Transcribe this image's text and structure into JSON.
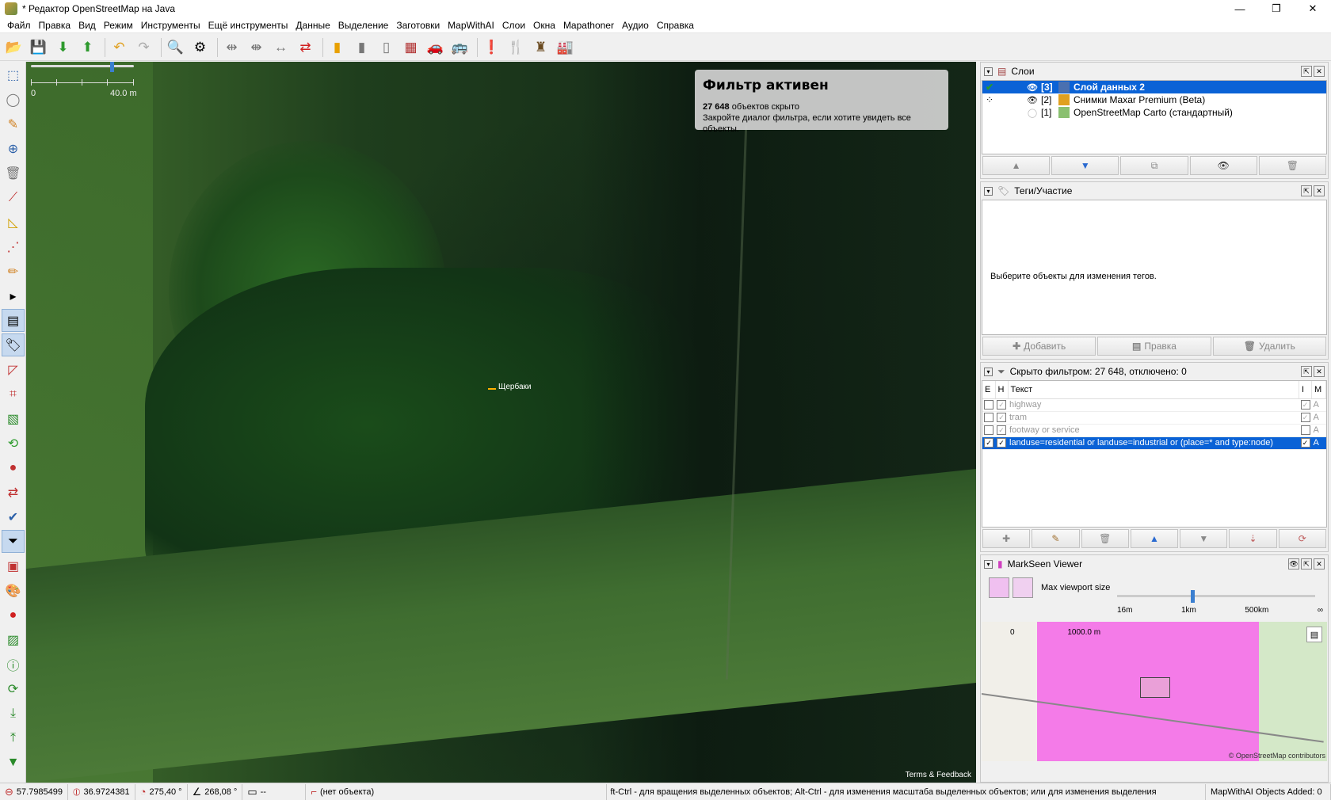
{
  "window": {
    "title": "* Редактор OpenStreetMap на Java",
    "controls": [
      "—",
      "❐",
      "✕"
    ]
  },
  "menu": [
    "Файл",
    "Правка",
    "Вид",
    "Режим",
    "Инструменты",
    "Ещё инструменты",
    "Данные",
    "Выделение",
    "Заготовки",
    "MapWithAI",
    "Слои",
    "Окна",
    "Mapathoner",
    "Аудио",
    "Справка"
  ],
  "toolbar_icons": [
    "open-icon",
    "save-icon",
    "download-icon",
    "upload-icon",
    "undo-icon",
    "redo-icon",
    "zoom-icon",
    "preferences-icon",
    "align-icon",
    "distribute-icon",
    "split-icon",
    "reverse-icon",
    "highway-icon",
    "road-icon",
    "pole-icon",
    "wall-icon",
    "car-icon",
    "bus-icon",
    "warning-icon",
    "restaurant-icon",
    "castle-icon",
    "factory-icon"
  ],
  "left_tools": [
    "select-icon",
    "lasso-icon",
    "draw-icon",
    "zoom-icon",
    "delete-icon",
    "improve-way-icon",
    "measure-icon",
    "split-way-icon",
    "paint-icon",
    "more-icon",
    "layers-icon",
    "tags-icon",
    "relation-icon",
    "node-icon",
    "map-icon",
    "sync-icon",
    "group-icon",
    "conflict-icon",
    "validate-icon",
    "filter-icon",
    "notes-icon",
    "palette-icon",
    "marker-icon",
    "image-icon",
    "info-icon",
    "history-icon",
    "download-icon",
    "upload-icon",
    "filter-toggle-icon"
  ],
  "map": {
    "scale_left": "0",
    "scale_right": "40.0 m",
    "filter_title": "Фильтр активен",
    "filter_count": "27 648",
    "filter_count_suffix": " объектов скрыто",
    "filter_hint": "Закройте диалог фильтра, если хотите увидеть все объекты.",
    "place_label": "Щербаки",
    "attribution": "Terms & Feedback"
  },
  "layers_panel": {
    "title": "Слои",
    "layers": [
      {
        "num": "[3]",
        "name": "Слой данных 2",
        "selected": true
      },
      {
        "num": "[2]",
        "name": "Снимки Maxar Premium (Beta)",
        "selected": false
      },
      {
        "num": "[1]",
        "name": "OpenStreetMap Carto (стандартный)",
        "selected": false
      }
    ]
  },
  "tags_panel": {
    "title": "Теги/Участие",
    "empty_message": "Выберите объекты для изменения тегов.",
    "add_label": "Добавить",
    "edit_label": "Правка",
    "delete_label": "Удалить"
  },
  "filter_panel": {
    "title": "Скрыто фильтром: 27 648, отключено: 0",
    "col_e": "E",
    "col_h": "H",
    "col_text": "Текст",
    "col_i": "I",
    "col_m": "M",
    "rows": [
      {
        "text": "highway",
        "m": "A",
        "selected": false
      },
      {
        "text": "tram",
        "m": "A",
        "selected": false
      },
      {
        "text": "footway or service",
        "m": "A",
        "selected": false
      },
      {
        "text": "landuse=residential or landuse=industrial or (place=* and type:node)",
        "m": "A",
        "selected": true
      }
    ]
  },
  "markseen_panel": {
    "title": "MarkSeen Viewer",
    "slider_label": "Max viewport size",
    "ticks": [
      "16m",
      "1km",
      "500km",
      "∞"
    ],
    "minimap_scale_left": "0",
    "minimap_scale_right": "1000.0 m",
    "minimap_attribution": "© OpenStreetMap contributors"
  },
  "status": {
    "lat": "57.7985499",
    "lon": "36.9724381",
    "heading": "275,40 °",
    "angle": "268,08 °",
    "distance": "--",
    "object": "(нет объекта)",
    "hint": "ft-Ctrl - для вращения выделенных объектов; Alt-Ctrl - для изменения масштаба выделенных объектов; или для изменения выделения",
    "mapwithai": "MapWithAI Objects Added: 0"
  }
}
